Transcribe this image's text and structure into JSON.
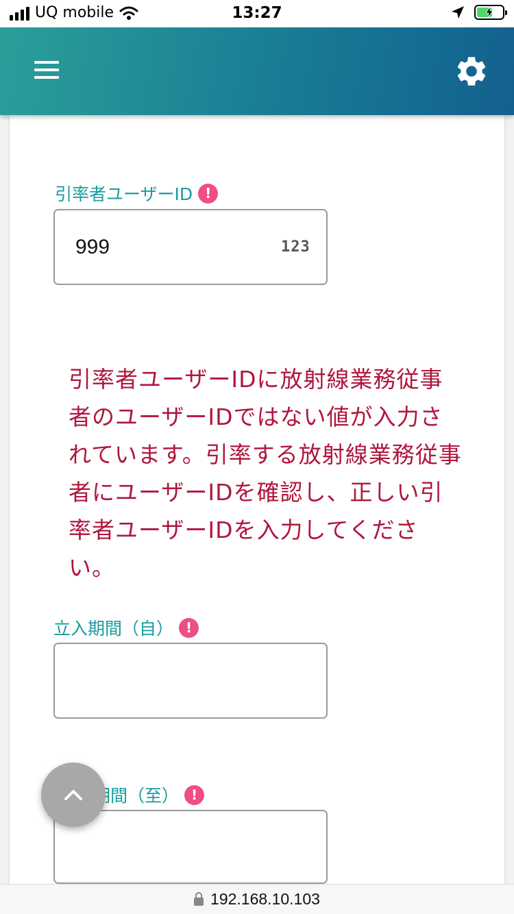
{
  "status_bar": {
    "carrier": "UQ mobile",
    "time": "13:27",
    "battery_level": 0.6,
    "icons": [
      "signal-icon",
      "wifi-icon",
      "location-arrow-icon",
      "battery-charging-icon"
    ]
  },
  "app_bar": {
    "icons": [
      "menu-icon",
      "settings-gear-icon"
    ],
    "color_start": "#2a9f9a",
    "color_end": "#13608f"
  },
  "form": {
    "leader_id": {
      "label": "引率者ユーザーID",
      "value": "999",
      "keyboard_hint": "123"
    },
    "error_message": "引率者ユーザーIDに放射線業務従事者のユーザーIDではない値が入力されています。引率する放射線業務従事者にユーザーIDを確認し、正しい引率者ユーザーIDを入力してください。",
    "period_from": {
      "label": "立入期間（自）",
      "value": ""
    },
    "period_to": {
      "label": "期間（至）",
      "value": ""
    },
    "required_icon": "!"
  },
  "url_bar": {
    "url": "192.168.10.103"
  },
  "colors": {
    "label": "#1a9aa0",
    "error": "#b0163c",
    "required_badge": "#ef4e82"
  }
}
